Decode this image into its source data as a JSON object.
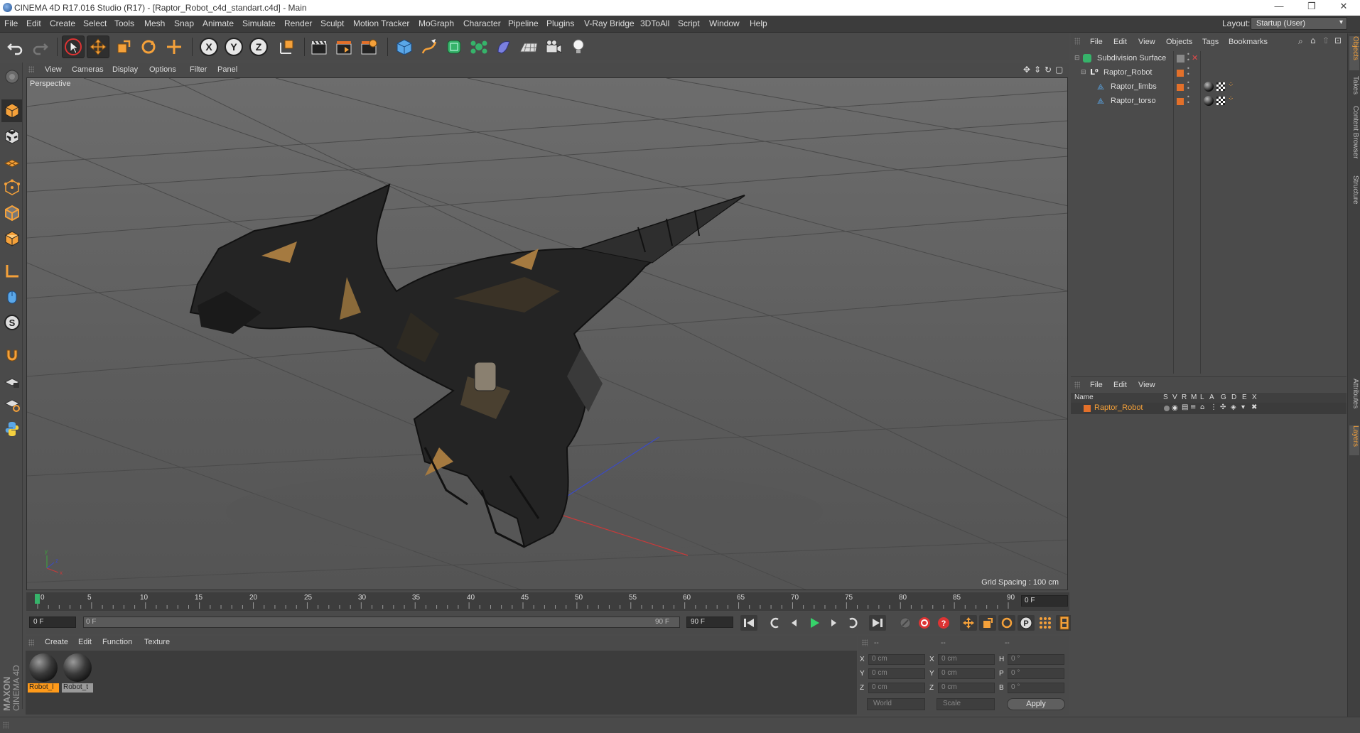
{
  "window": {
    "title": "CINEMA 4D R17.016 Studio (R17) - [Raptor_Robot_c4d_standart.c4d] - Main",
    "controls": [
      "—",
      "❐",
      "✕"
    ]
  },
  "menubar": {
    "items": [
      "File",
      "Edit",
      "Create",
      "Select",
      "Tools",
      "Mesh",
      "Snap",
      "Animate",
      "Simulate",
      "Render",
      "Sculpt",
      "Motion Tracker",
      "MoGraph",
      "Character",
      "Pipeline",
      "Plugins",
      "V-Ray Bridge",
      "3DToAll",
      "Script",
      "Window",
      "Help"
    ],
    "layout_label": "Layout:",
    "layout_value": "Startup (User)"
  },
  "toolbar": {
    "axis_x": "X",
    "axis_y": "Y",
    "axis_z": "Z"
  },
  "viewport": {
    "menu": [
      "View",
      "Cameras",
      "Display",
      "Options",
      "Filter",
      "Panel"
    ],
    "label": "Perspective",
    "grid_spacing": "Grid Spacing : 100 cm"
  },
  "timeline": {
    "ticks": [
      "0",
      "5",
      "10",
      "15",
      "20",
      "25",
      "30",
      "35",
      "40",
      "45",
      "50",
      "55",
      "60",
      "65",
      "70",
      "75",
      "80",
      "85",
      "90"
    ],
    "current_frame": "0 F",
    "start_field": "0 F",
    "range_start": "0 F",
    "range_end": "90 F",
    "end_field": "90 F"
  },
  "material_manager": {
    "menu": [
      "Create",
      "Edit",
      "Function",
      "Texture"
    ],
    "materials": [
      {
        "label": "Robot_l"
      },
      {
        "label": "Robot_t"
      }
    ],
    "brand_line1": "MAXON",
    "brand_line2": "CINEMA 4D"
  },
  "coordinates": {
    "headers": [
      "--",
      "--",
      "--"
    ],
    "rows": [
      {
        "a": "X",
        "av": "0 cm",
        "b": "X",
        "bv": "0 cm",
        "c": "H",
        "cv": "0 °"
      },
      {
        "a": "Y",
        "av": "0 cm",
        "b": "Y",
        "bv": "0 cm",
        "c": "P",
        "cv": "0 °"
      },
      {
        "a": "Z",
        "av": "0 cm",
        "b": "Z",
        "bv": "0 cm",
        "c": "B",
        "cv": "0 °"
      }
    ],
    "mode": "World",
    "scale": "Scale",
    "apply": "Apply"
  },
  "object_manager": {
    "menu": [
      "File",
      "Edit",
      "View",
      "Objects",
      "Tags",
      "Bookmarks"
    ],
    "objects": [
      {
        "name": "Subdivision Surface"
      },
      {
        "name": "Raptor_Robot"
      },
      {
        "name": "Raptor_limbs"
      },
      {
        "name": "Raptor_torso"
      }
    ]
  },
  "layer_manager": {
    "menu": [
      "File",
      "Edit",
      "View"
    ],
    "columns": [
      "Name",
      "S",
      "V",
      "R",
      "M",
      "L",
      "A",
      "G",
      "D",
      "E",
      "X"
    ],
    "layers": [
      {
        "name": "Raptor_Robot",
        "color": "#e3702a"
      }
    ]
  },
  "right_tabs": [
    "Objects",
    "Takes",
    "Content Browser",
    "Structure",
    "Attributes",
    "Layers"
  ],
  "colors": {
    "accent": "#f5a13a",
    "layer_orange": "#e3702a",
    "axis_x": "#c83a3a",
    "axis_y": "#3aa83a",
    "axis_z": "#3a4ac8"
  }
}
